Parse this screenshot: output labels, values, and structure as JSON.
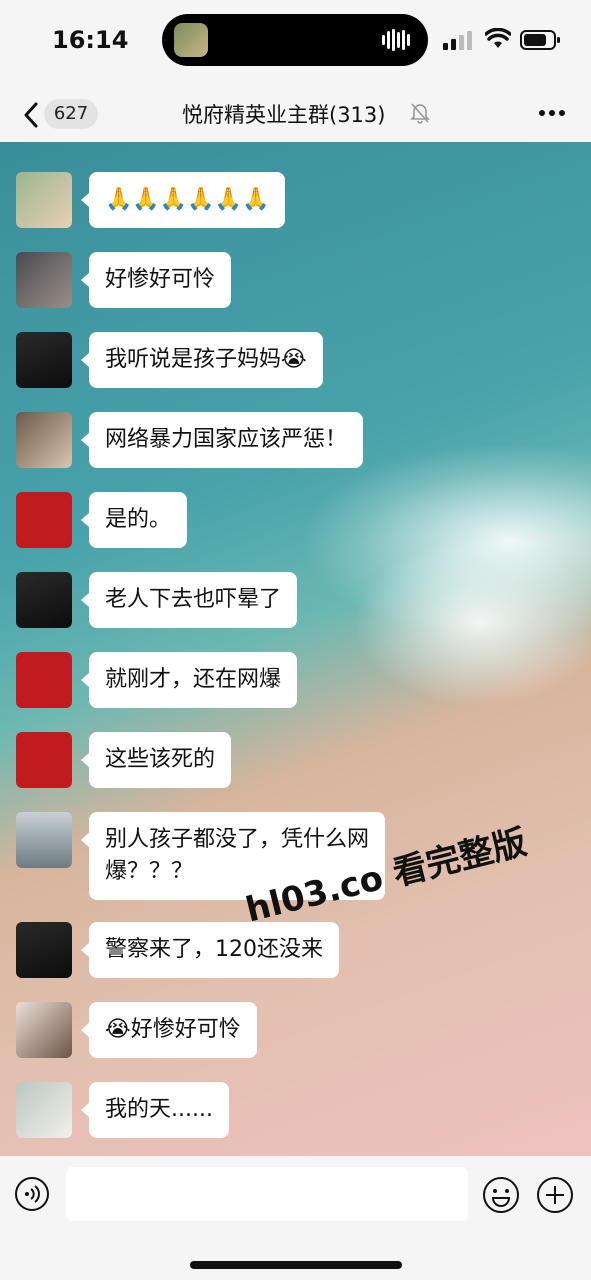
{
  "status_bar": {
    "time": "16:14"
  },
  "nav": {
    "back_count": "627",
    "title": "悦府精英业主群(313)"
  },
  "messages": [
    {
      "avatar": "av-green",
      "text": "🙏🙏🙏🙏🙏🙏"
    },
    {
      "avatar": "av-street",
      "text": "好惨好可怜"
    },
    {
      "avatar": "av-dark",
      "text": "我听说是孩子妈妈😭"
    },
    {
      "avatar": "av-child",
      "text": "网络暴力国家应该严惩！"
    },
    {
      "avatar": "av-red",
      "text": "是的。"
    },
    {
      "avatar": "av-dark",
      "text": "老人下去也吓晕了"
    },
    {
      "avatar": "av-red",
      "text": "就刚才，还在网爆"
    },
    {
      "avatar": "av-red",
      "text": "这些该死的"
    },
    {
      "avatar": "av-grey",
      "text": "别人孩子都没了，凭什么网\n爆？？？"
    },
    {
      "avatar": "av-dark",
      "text": "警察来了，120还没来"
    },
    {
      "avatar": "av-woman",
      "text": "😭好惨好可怜"
    },
    {
      "avatar": "av-woman2",
      "text": "我的天......"
    }
  ],
  "watermark": "hl03.co 看完整版"
}
